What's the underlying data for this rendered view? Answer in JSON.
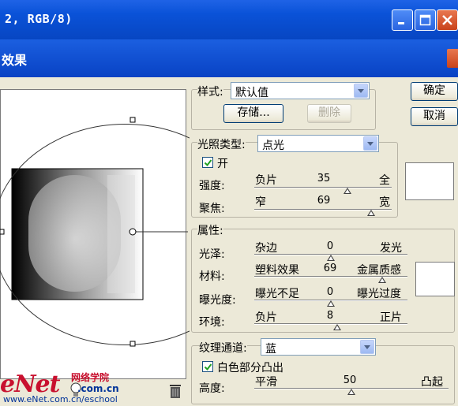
{
  "window": {
    "outer_title": "2, RGB/8)",
    "inner_title": "效果"
  },
  "style_group": {
    "label": "样式:",
    "value": "默认值",
    "save_label": "存储...",
    "delete_label": "删除"
  },
  "buttons": {
    "ok": "确定",
    "cancel": "取消"
  },
  "light": {
    "type_label": "光照类型:",
    "type_value": "点光",
    "on_label": "开",
    "on_checked": true,
    "intensity": {
      "label": "强度:",
      "min": "负片",
      "max": "全",
      "value": "35"
    },
    "focus": {
      "label": "聚焦:",
      "min": "窄",
      "max": "宽",
      "value": "69"
    }
  },
  "properties": {
    "title": "属性:",
    "gloss": {
      "label": "光泽:",
      "min": "杂边",
      "max": "发光",
      "value": "0"
    },
    "material": {
      "label": "材料:",
      "min": "塑料效果",
      "max": "金属质感",
      "value": "69"
    },
    "exposure": {
      "label": "曝光度:",
      "min": "曝光不足",
      "max": "曝光过度",
      "value": "0"
    },
    "ambience": {
      "label": "环境:",
      "min": "负片",
      "max": "正片",
      "value": "8"
    }
  },
  "texture": {
    "label": "纹理通道:",
    "value": "蓝",
    "white_high_label": "白色部分凸出",
    "white_high_checked": true,
    "height": {
      "label": "高度:",
      "min": "平滑",
      "max": "凸起",
      "value": "50"
    }
  },
  "watermark": {
    "brand": "eNet",
    "cn": "网络学院",
    "domain": ".com.cn",
    "url": "www.eNet.com.cn/eschool"
  },
  "colors": {
    "titlebar": "#0a52d8",
    "dialog_bg": "#ece9d8"
  }
}
